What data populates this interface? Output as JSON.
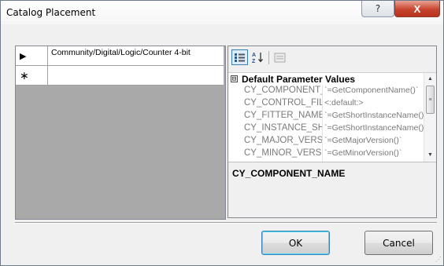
{
  "window": {
    "title": "Catalog Placement",
    "help_label": "?",
    "close_label": "X"
  },
  "grid": {
    "rows": [
      {
        "marker": "▶",
        "value": "Community/Digital/Logic/Counter 4-bit"
      },
      {
        "marker": "∗",
        "value": ""
      }
    ]
  },
  "property_grid": {
    "toolbar": {
      "categorized_icon": "categorized-view-icon",
      "alphabetical_icon": "alphabetical-sort-icon",
      "property_pages_icon": "property-pages-icon"
    },
    "category": {
      "expander": "⊟",
      "label": "Default Parameter Values"
    },
    "properties": [
      {
        "name": "CY_COMPONENT_NAME",
        "value": "`=GetComponentName()`"
      },
      {
        "name": "CY_CONTROL_FILE",
        "value": "<:default:>"
      },
      {
        "name": "CY_FITTER_NAME",
        "value": "`=GetShortInstanceName()`"
      },
      {
        "name": "CY_INSTANCE_SHORT_NAME",
        "value": "`=GetShortInstanceName()`"
      },
      {
        "name": "CY_MAJOR_VERSION",
        "value": "`=GetMajorVersion()`"
      },
      {
        "name": "CY_MINOR_VERSION",
        "value": "`=GetMinorVersion()`"
      }
    ],
    "description_title": "CY_COMPONENT_NAME"
  },
  "buttons": {
    "ok_label": "OK",
    "cancel_label": "Cancel"
  },
  "colors": {
    "title_close": "#c7452e",
    "selected_toolbar": "#dcecfc",
    "grid_background": "#a9a9a9",
    "ok_focus": "#3c7fb1"
  }
}
